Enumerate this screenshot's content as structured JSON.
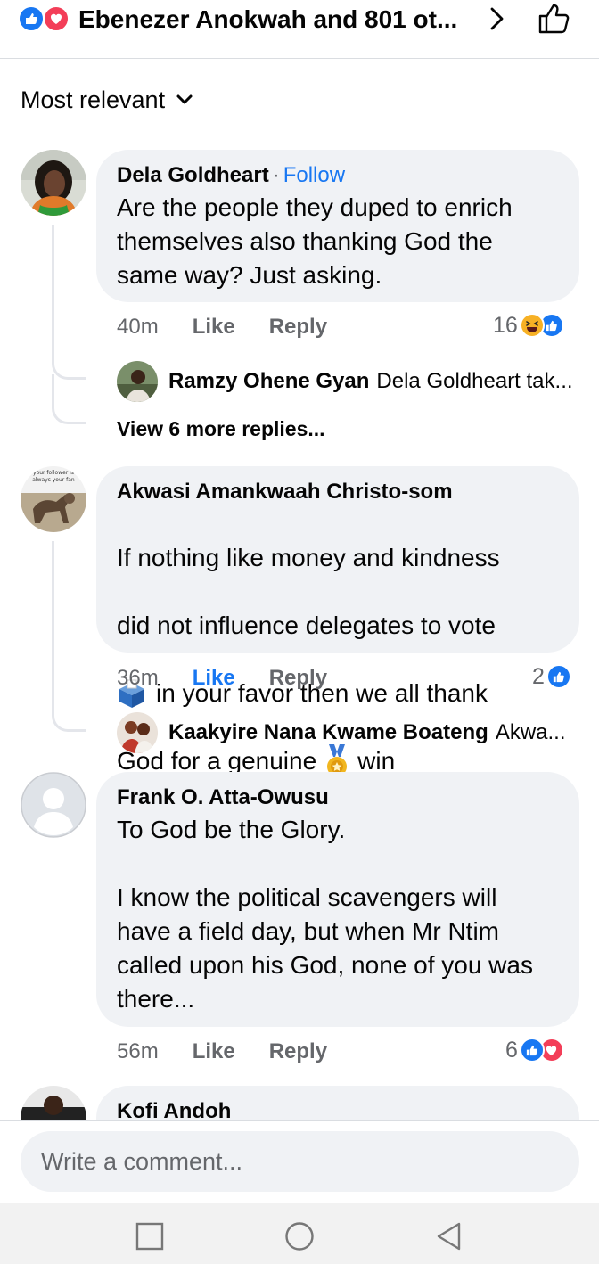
{
  "header": {
    "title": "Ebenezer Anokwah and 801 ot...",
    "icons": [
      "like-reaction-icon",
      "love-reaction-icon",
      "chevron-right-icon",
      "thumbs-up-outline-icon"
    ]
  },
  "sort": {
    "label": "Most relevant"
  },
  "comments": [
    {
      "name": "Dela Goldheart",
      "separator": "·",
      "follow": "Follow",
      "text": "Are the people they duped to enrich\nthemselves also thanking God the\nsame way? Just asking.",
      "time": "40m",
      "like": "Like",
      "reply": "Reply",
      "count": "16",
      "reply_preview": {
        "name": "Ramzy Ohene Gyan",
        "text": "Dela Goldheart tak..."
      },
      "view_more": "View 6 more replies..."
    },
    {
      "name": "Akwasi Amankwaah Christo-som",
      "text_1": "If nothing like money and kindness",
      "text_2": "did not influence delegates to vote",
      "text_3": "in your favor then we all thank",
      "text_4a": "God for a genuine",
      "text_4b": "win",
      "time": "36m",
      "like": "Like",
      "reply": "Reply",
      "count": "2",
      "avatar_caption_1": "your follower is",
      "avatar_caption_2": "always your fan",
      "reply_preview": {
        "name": "Kaakyire Nana Kwame Boateng",
        "text": "Akwa..."
      }
    },
    {
      "name": "Frank O. Atta-Owusu",
      "text": "To God be the Glory.\n\nI know the political scavengers will\nhave a field day, but when Mr Ntim\ncalled upon his God, none of you was\nthere...",
      "time": "56m",
      "like": "Like",
      "reply": "Reply",
      "count": "6"
    },
    {
      "name": "Kofi Andoh"
    }
  ],
  "compose": {
    "placeholder": "Write a comment..."
  },
  "colors": {
    "accent": "#1877f2",
    "love": "#f33e58",
    "bubble": "#f0f2f5",
    "muted": "#65676b"
  }
}
